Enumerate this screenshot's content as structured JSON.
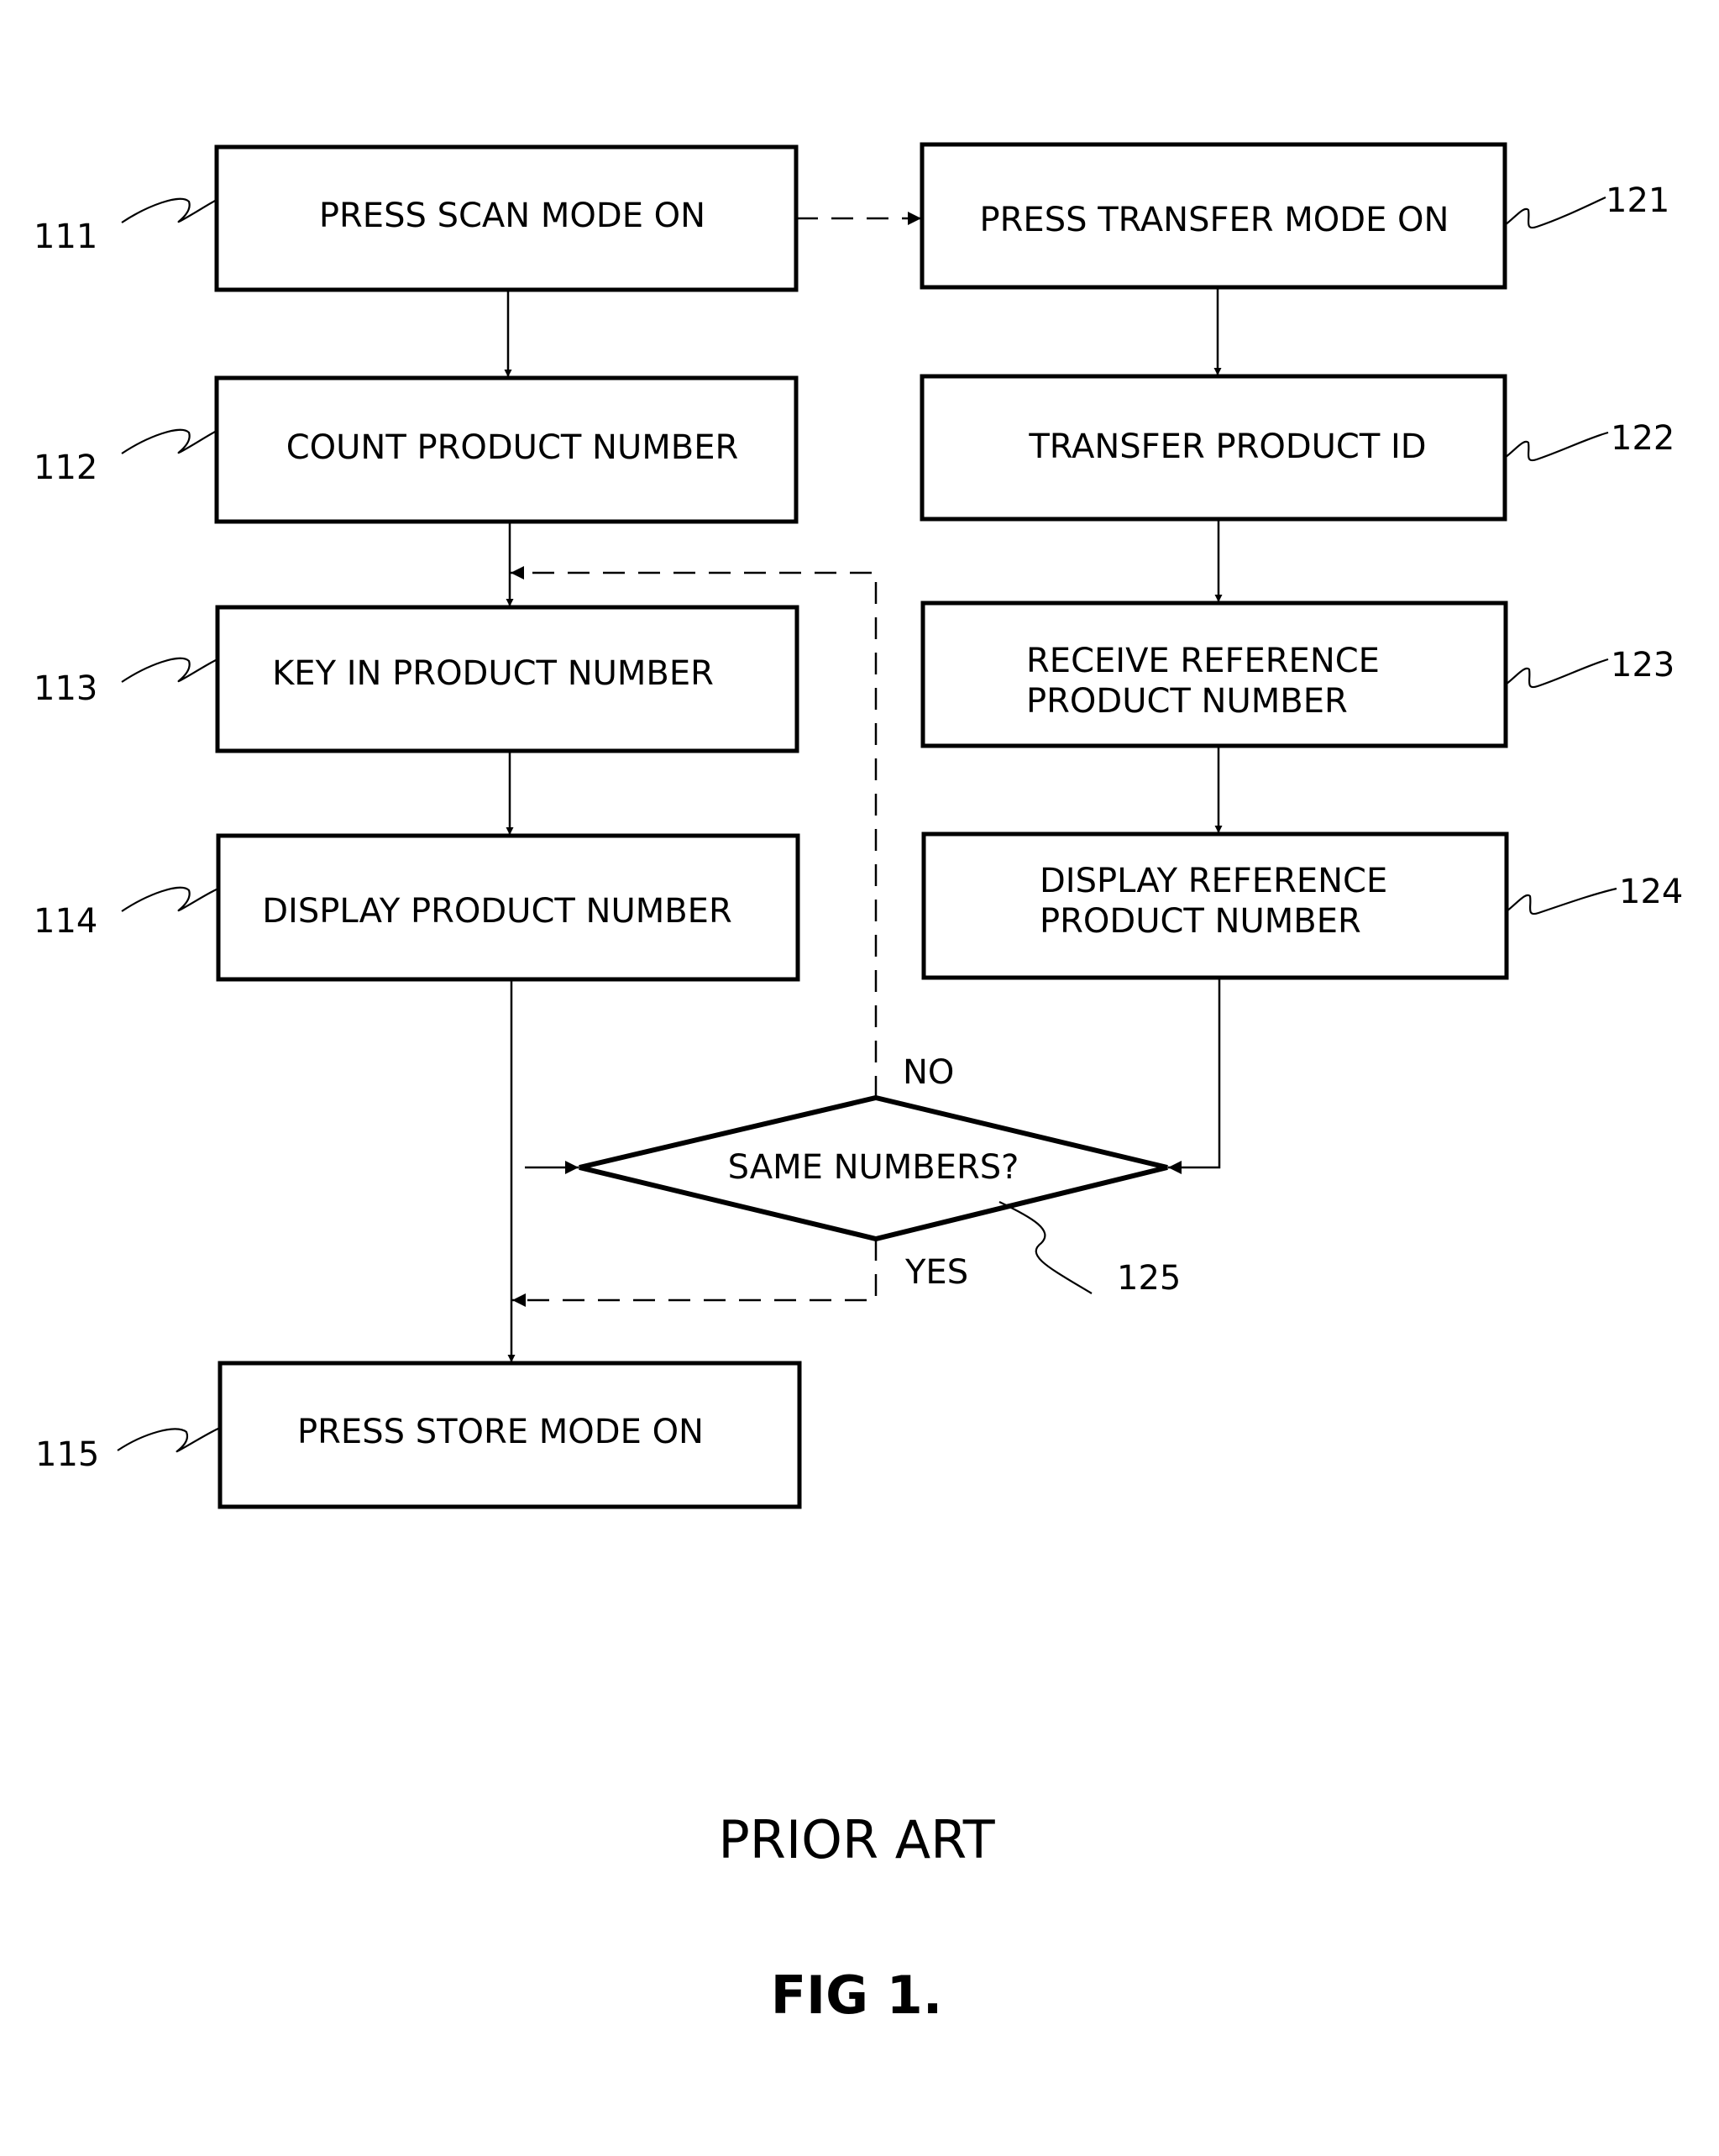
{
  "figure": {
    "caption": "PRIOR ART",
    "title": "FIG 1."
  },
  "steps": {
    "s111": {
      "ref": "111",
      "lines": [
        "PRESS SCAN MODE ON"
      ]
    },
    "s112": {
      "ref": "112",
      "lines": [
        "COUNT PRODUCT NUMBER"
      ]
    },
    "s113": {
      "ref": "113",
      "lines": [
        "KEY IN PRODUCT NUMBER"
      ]
    },
    "s114": {
      "ref": "114",
      "lines": [
        "DISPLAY PRODUCT NUMBER"
      ]
    },
    "s115": {
      "ref": "115",
      "lines": [
        "PRESS STORE MODE ON"
      ]
    },
    "s121": {
      "ref": "121",
      "lines": [
        "PRESS TRANSFER MODE ON"
      ]
    },
    "s122": {
      "ref": "122",
      "lines": [
        "TRANSFER PRODUCT ID"
      ]
    },
    "s123": {
      "ref": "123",
      "lines": [
        "RECEIVE REFERENCE",
        "PRODUCT NUMBER"
      ]
    },
    "s124": {
      "ref": "124",
      "lines": [
        "DISPLAY REFERENCE",
        "PRODUCT NUMBER"
      ]
    }
  },
  "decision": {
    "ref": "125",
    "label": "SAME NUMBERS?",
    "no_label": "NO",
    "yes_label": "YES"
  },
  "flows": [
    {
      "from": "111",
      "to": "121",
      "style": "dashed"
    },
    {
      "from": "111",
      "to": "112",
      "style": "solid"
    },
    {
      "from": "112",
      "to": "113",
      "style": "solid"
    },
    {
      "from": "113",
      "to": "114",
      "style": "solid"
    },
    {
      "from": "114",
      "to": "115",
      "style": "solid"
    },
    {
      "from": "114",
      "to": "125",
      "style": "solid"
    },
    {
      "from": "121",
      "to": "122",
      "style": "solid"
    },
    {
      "from": "122",
      "to": "123",
      "style": "solid"
    },
    {
      "from": "123",
      "to": "124",
      "style": "solid"
    },
    {
      "from": "124",
      "to": "125",
      "style": "solid"
    },
    {
      "from": "125",
      "to": "113",
      "style": "dashed",
      "condition": "NO"
    },
    {
      "from": "125",
      "to": "115",
      "style": "dashed",
      "condition": "YES"
    }
  ]
}
